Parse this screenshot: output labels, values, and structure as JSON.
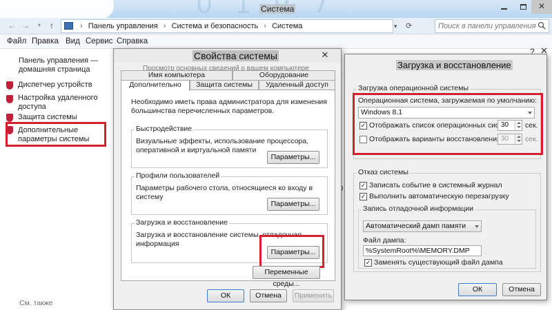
{
  "window": {
    "title": "Система",
    "watermark": "0 1 9 7"
  },
  "address": {
    "crumbs": [
      "Панель управления",
      "Система и безопасность",
      "Система"
    ],
    "search_placeholder": "Поиск в панели управления"
  },
  "menu": [
    "Файл",
    "Правка",
    "Вид",
    "Сервис",
    "Справка"
  ],
  "sidebar": {
    "home": "Панель управления — домашняя страница",
    "items": [
      "Диспетчер устройств",
      "Настройка удаленного доступа",
      "Защита системы",
      "Дополнительные параметры системы"
    ],
    "see_also": "См. также"
  },
  "background_fragments": [
    "за",
    "2.0",
    "тр",
    "ц",
    "ц"
  ],
  "system_properties": {
    "title": "Свойства системы",
    "overlap_text": "Просмотр основных сведений о вашем компьютере",
    "tabs_row1": [
      "Имя компьютера",
      "Оборудование"
    ],
    "tabs_row2": [
      "Дополнительно",
      "Защита системы",
      "Удаленный доступ"
    ],
    "intro": "Необходимо иметь права администратора для изменения большинства перечисленных параметров.",
    "performance": {
      "title": "Быстродействие",
      "desc": "Визуальные эффекты, использование процессора, оперативной и виртуальной памяти",
      "button": "Параметры..."
    },
    "profiles": {
      "title": "Профили пользователей",
      "desc": "Параметры рабочего стола, относящиеся ко входу в систему",
      "button": "Параметры..."
    },
    "startup": {
      "title": "Загрузка и восстановление",
      "desc": "Загрузка и восстановление системы, отладочная информация",
      "button": "Параметры..."
    },
    "env_button": "Переменные среды...",
    "ok": "ОК",
    "cancel": "Отмена",
    "apply": "Применить"
  },
  "startup_recovery": {
    "title": "Загрузка и восстановление",
    "boot": {
      "legend": "Загрузка операционной системы",
      "default_os_label": "Операционная система, загружаемая по умолчанию:",
      "default_os_value": "Windows 8.1",
      "show_list_label": "Отображать список операционных систем:",
      "show_list_checked": true,
      "show_list_seconds": "30",
      "show_recovery_label": "Отображать варианты восстановления:",
      "show_recovery_checked": false,
      "show_recovery_seconds": "30",
      "seconds_unit": "сек."
    },
    "failure": {
      "legend": "Отказ системы",
      "write_event_label": "Записать событие в системный журнал",
      "write_event_checked": true,
      "auto_restart_label": "Выполнить автоматическую перезагрузку",
      "auto_restart_checked": true,
      "debug": {
        "legend": "Запись отладочной информации",
        "dump_type": "Автоматический дамп памяти",
        "dump_file_label": "Файл дампа:",
        "dump_file_value": "%SystemRoot%\\MEMORY.DMP",
        "overwrite_label": "Заменять существующий файл дампа",
        "overwrite_checked": true
      }
    },
    "ok": "ОК",
    "cancel": "Отмена"
  },
  "colors": {
    "highlight": "#d61f2c",
    "shield": "#c0203a",
    "titlebar": "#b9d6f1"
  }
}
